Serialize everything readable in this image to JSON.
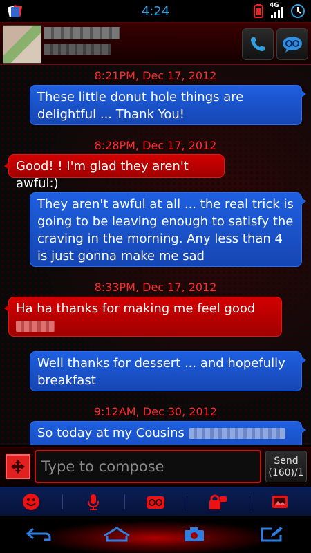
{
  "status_bar": {
    "time": "4:24",
    "network": "4G",
    "icons": [
      "cards-icon",
      "battery-alert-icon",
      "signal-icon",
      "clock-icon"
    ]
  },
  "header": {
    "icons": [
      "phone-icon",
      "go-sms-icon"
    ]
  },
  "conversation": {
    "items": [
      {
        "type": "timestamp",
        "text": "8:21PM, Dec 17, 2012"
      },
      {
        "type": "outgoing",
        "text": "These little donut hole things are delightful ... Thank You!"
      },
      {
        "type": "timestamp",
        "text": "8:28PM, Dec 17, 2012"
      },
      {
        "type": "incoming",
        "text": "Good! ! I'm glad they aren't awful:)"
      },
      {
        "type": "outgoing",
        "text": "They aren't awful at all ... the real trick is going to be leaving enough to satisfy the craving in the morning. Any less than 4 is just gonna make me sad"
      },
      {
        "type": "timestamp",
        "text": "8:33PM, Dec 17, 2012"
      },
      {
        "type": "incoming",
        "text": "Ha ha thanks for making me feel good"
      },
      {
        "type": "outgoing",
        "text": "Well thanks for dessert ... and hopefully breakfast"
      },
      {
        "type": "timestamp",
        "text": "9:12AM, Dec 30, 2012"
      },
      {
        "type": "outgoing",
        "text": "So today at my Cousins"
      }
    ]
  },
  "compose": {
    "placeholder": "Type to compose",
    "send_label": "Send",
    "counter": "(160)/1"
  },
  "toolbar": {
    "items": [
      "emoji-icon",
      "microphone-icon",
      "go-sticker-icon",
      "lock-message-icon",
      "gallery-icon"
    ]
  },
  "navbar": {
    "items": [
      "back-icon",
      "home-icon",
      "camera-icon",
      "compose-icon"
    ]
  },
  "colors": {
    "outgoing_bubble": "#1e5fe0",
    "incoming_bubble": "#d30000",
    "timestamp": "#ff2a2a",
    "status_time": "#2f9fe0"
  }
}
